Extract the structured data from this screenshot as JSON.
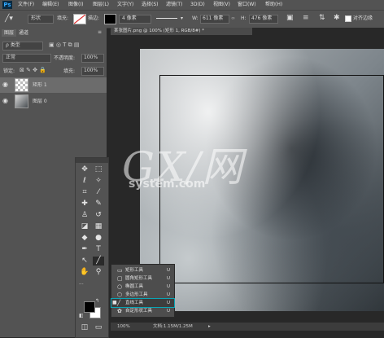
{
  "app": {
    "logo": "Ps"
  },
  "menu": [
    "文件(F)",
    "编辑(E)",
    "图像(I)",
    "图层(L)",
    "文字(Y)",
    "选择(S)",
    "滤镜(T)",
    "3D(D)",
    "视图(V)",
    "窗口(W)",
    "帮助(H)"
  ],
  "options": {
    "mode": "形状",
    "fill_label": "填充:",
    "stroke_label": "描边:",
    "stroke_size": "4 像素",
    "w_label": "W:",
    "w_value": "611 像素",
    "h_label": "H:",
    "h_value": "476 像素",
    "align_edges": "对齐边缘"
  },
  "panel": {
    "tabs": [
      "图层",
      "通道"
    ],
    "kind_filter": "ρ 类型",
    "blend_mode": "正常",
    "opacity_label": "不透明度:",
    "opacity_value": "100%",
    "lock_label": "锁定:",
    "fill_label": "填充:",
    "fill_value": "100%",
    "layers": [
      {
        "name": "矩形 1"
      },
      {
        "name": "图层 0"
      }
    ]
  },
  "document": {
    "tab_title": "某张图片.png @ 100% (矩形 1, RGB/8#) *",
    "zoom": "100%",
    "doc_info": "文档:1.15M/1.25M"
  },
  "watermark": {
    "logo": "GX/网",
    "site": "system.com"
  },
  "toolbar": {
    "tools": [
      "move-icon",
      "marquee-icon",
      "lasso-icon",
      "magic-wand-icon",
      "crop-icon",
      "eyedropper-icon",
      "healing-icon",
      "brush-icon",
      "stamp-icon",
      "history-brush-icon",
      "eraser-icon",
      "gradient-icon",
      "blur-icon",
      "dodge-icon",
      "pen-icon",
      "type-icon",
      "path-select-icon",
      "line-icon",
      "hand-icon",
      "zoom-icon"
    ],
    "foreground_color": "#000000",
    "background_color": "#ffffff"
  },
  "flyout": {
    "items": [
      {
        "label": "矩形工具",
        "shortcut": "U",
        "icon": "rect-icon"
      },
      {
        "label": "圆角矩形工具",
        "shortcut": "U",
        "icon": "rounded-rect-icon"
      },
      {
        "label": "椭圆工具",
        "shortcut": "U",
        "icon": "ellipse-icon"
      },
      {
        "label": "多边形工具",
        "shortcut": "U",
        "icon": "polygon-icon"
      },
      {
        "label": "直线工具",
        "shortcut": "U",
        "icon": "line-icon",
        "selected": true
      },
      {
        "label": "自定形状工具",
        "shortcut": "U",
        "icon": "custom-shape-icon"
      }
    ]
  }
}
